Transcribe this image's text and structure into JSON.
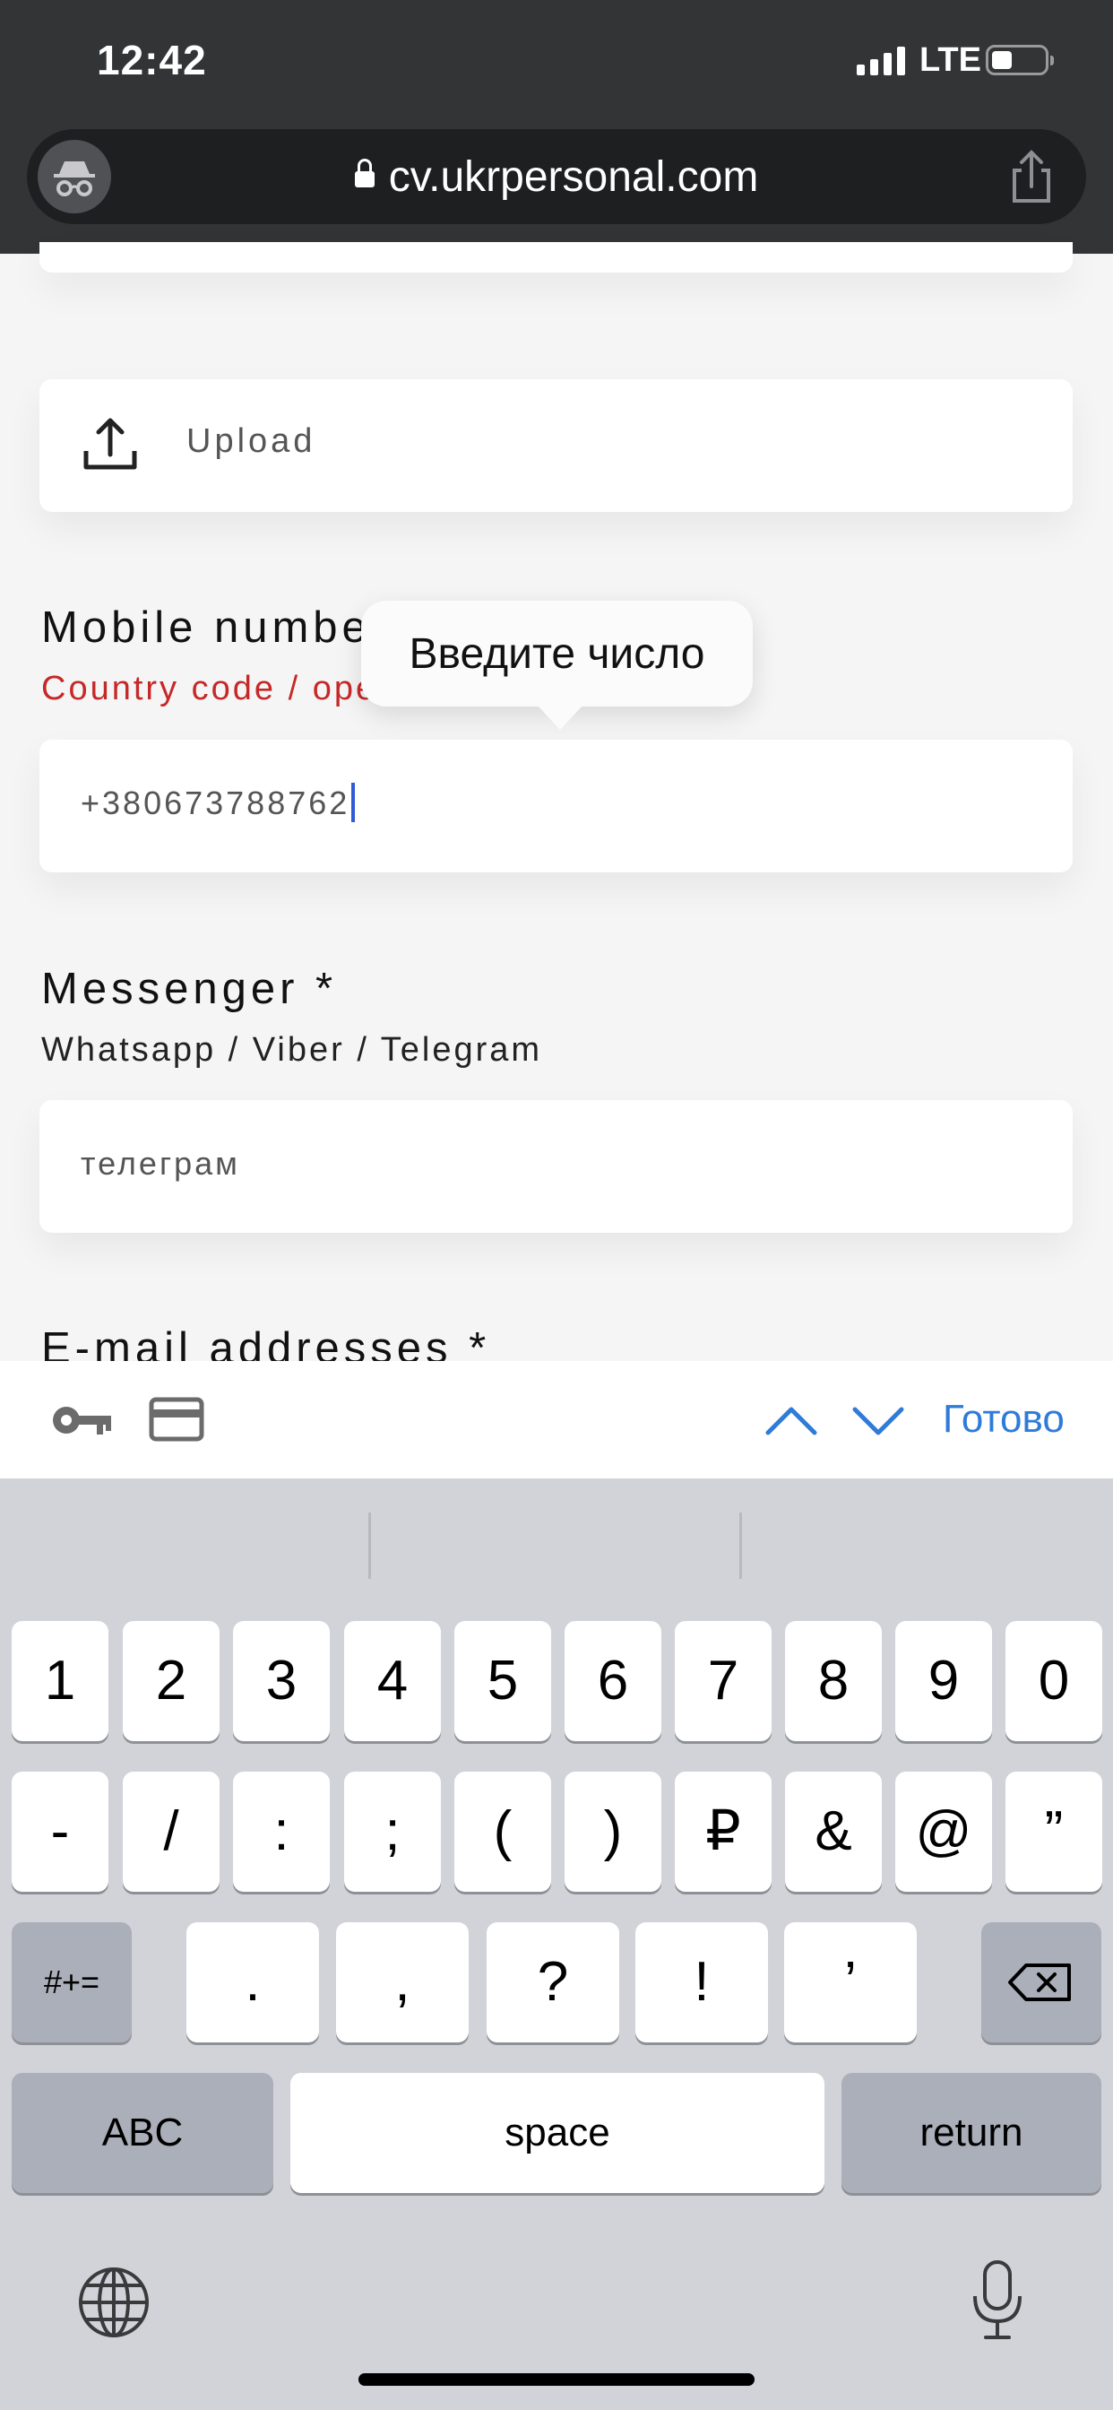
{
  "status": {
    "time": "12:42",
    "network": "LTE"
  },
  "browser": {
    "url": "cv.ukrpersonal.com"
  },
  "form": {
    "upload_label": "Upload",
    "mobile_label": "Mobile number",
    "mobile_hint": "Country code / operator code / number",
    "mobile_value": "+380673788762",
    "tooltip": "Введите число",
    "messenger_label": "Messenger *",
    "messenger_hint": "Whatsapp / Viber / Telegram",
    "messenger_value": "телеграм",
    "email_label": "E-mail addresses *"
  },
  "accessory": {
    "done_label": "Готово"
  },
  "keyboard": {
    "row1": [
      "1",
      "2",
      "3",
      "4",
      "5",
      "6",
      "7",
      "8",
      "9",
      "0"
    ],
    "row2": [
      "-",
      "/",
      ":",
      ";",
      "(",
      ")",
      "₽",
      "&",
      "@",
      "”"
    ],
    "row3": [
      ".",
      ",",
      "?",
      "!",
      "’"
    ],
    "more_symbols": "#+=",
    "abc": "ABC",
    "space": "space",
    "return": "return"
  }
}
